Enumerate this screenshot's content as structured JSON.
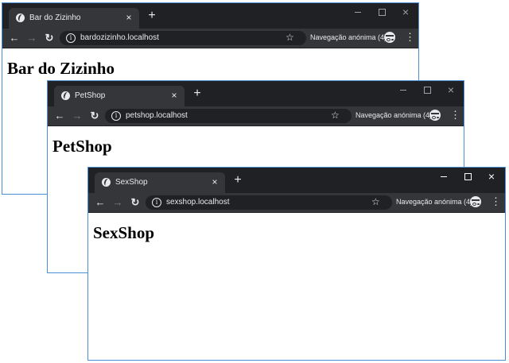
{
  "windows": [
    {
      "tab_title": "Bar do Zizinho",
      "url": "bardozizinho.localhost",
      "heading": "Bar do Zizinho",
      "incognito_label": "Navegação anónima (4)"
    },
    {
      "tab_title": "PetShop",
      "url": "petshop.localhost",
      "heading": "PetShop",
      "incognito_label": "Navegação anónima (4)"
    },
    {
      "tab_title": "SexShop",
      "url": "sexshop.localhost",
      "heading": "SexShop",
      "incognito_label": "Navegação anónima (4)"
    }
  ],
  "icons": {
    "close": "×",
    "new_tab": "+",
    "back": "←",
    "forward": "→",
    "reload": "↻",
    "star": "☆",
    "menu": "⋮",
    "info": "i"
  },
  "colors": {
    "titlebar": "#202124",
    "toolbar": "#35363a",
    "window_border": "#4a90d9"
  }
}
